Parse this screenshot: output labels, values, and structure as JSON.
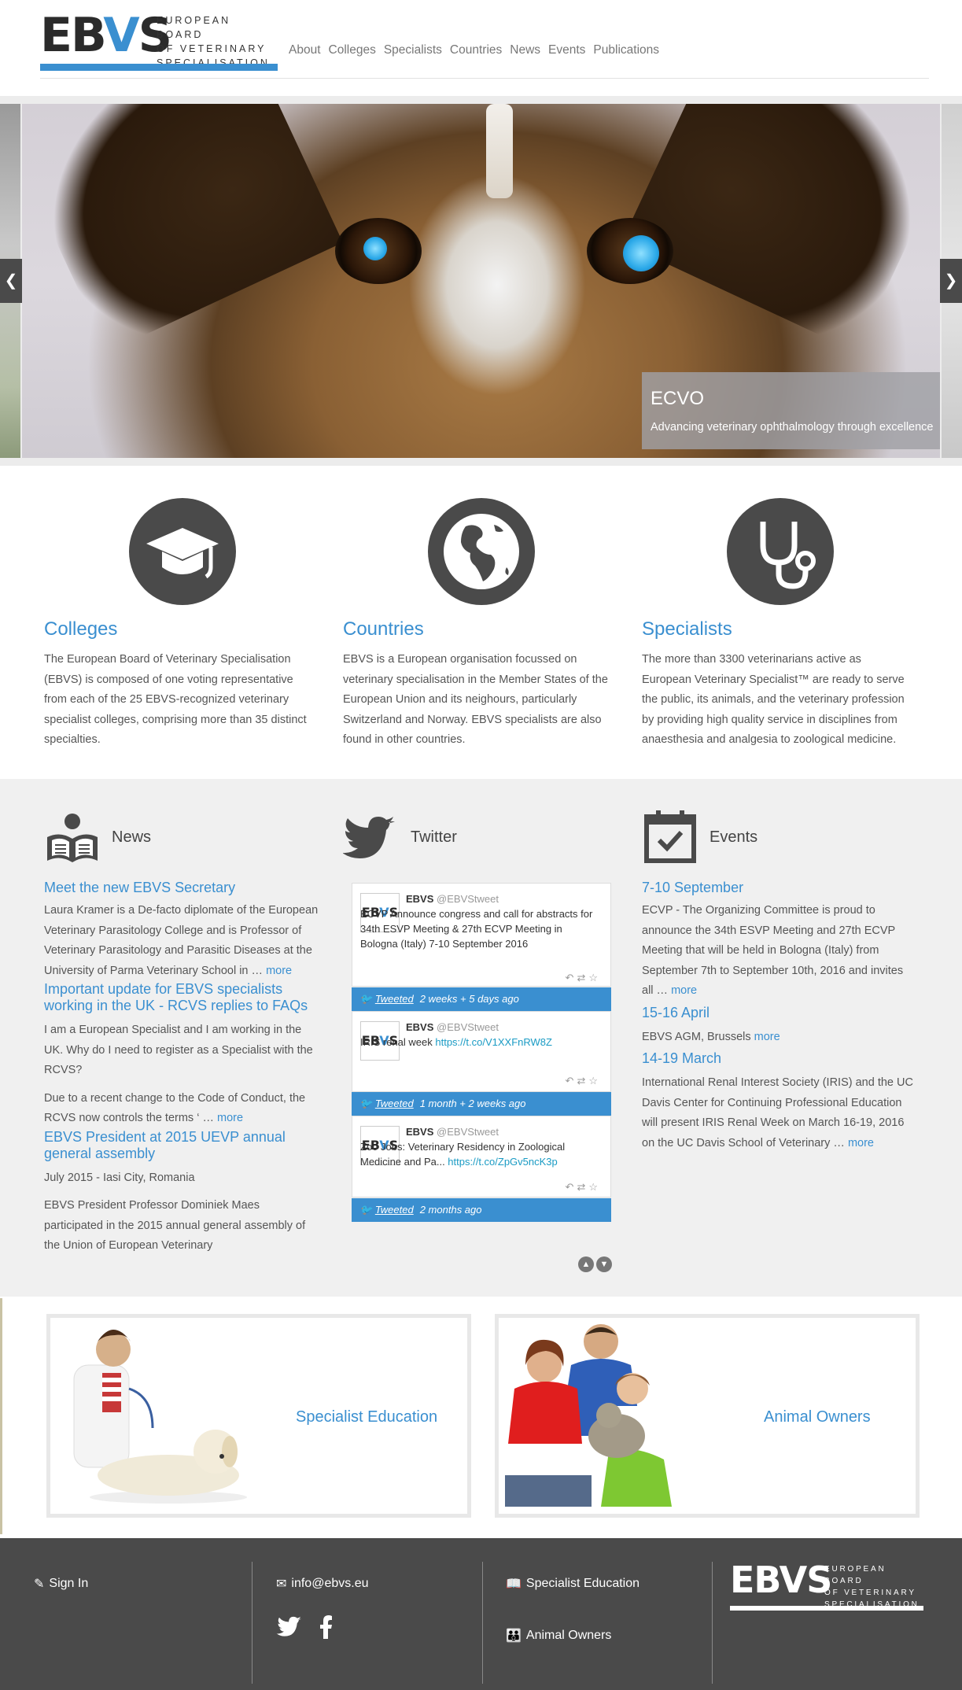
{
  "header": {
    "logo_mark_1": "EB",
    "logo_mark_v": "V",
    "logo_mark_2": "S",
    "logo_lines": [
      "EUROPEAN BOARD",
      "OF VETERINARY",
      "SPECIALISATION"
    ],
    "nav": [
      "About",
      "Colleges",
      "Specialists",
      "Countries",
      "News",
      "Events",
      "Publications"
    ]
  },
  "slider": {
    "caption_title": "ECVO",
    "caption_text": "Advancing veterinary ophthalmology through excellence"
  },
  "features": [
    {
      "title": "Colleges",
      "icon": "graduation-cap-icon",
      "text": "The European Board of Veterinary Specialisation (EBVS) is composed of one voting representative from each of the 25 EBVS-recognized veterinary specialist colleges, comprising more than 35 distinct specialties."
    },
    {
      "title": "Countries",
      "icon": "globe-icon",
      "text": "EBVS is a European organisation focussed on veterinary specialisation in the Member States of the European Union and its neighours, particularly Switzerland and Norway. EBVS specialists are also found in other countries."
    },
    {
      "title": "Specialists",
      "icon": "stethoscope-icon",
      "text": "The more than 3300 veterinarians active as European Veterinary Specialist™ are ready to serve the public, its animals, and the veterinary profession by providing high quality service in disciplines from anaesthesia and analgesia to zoological medicine."
    }
  ],
  "news": {
    "heading": "News",
    "items": [
      {
        "title": "Meet the new EBVS Secretary",
        "text": "Laura Kramer is a De-facto diplomate of the European Veterinary Parasitology College and is Professor of Veterinary Parasitology and Parasitic Diseases at the University of Parma Veterinary School in …",
        "more": "more"
      },
      {
        "title": "Important update for EBVS specialists working in the UK - RCVS replies to FAQs",
        "text": "I am a European Specialist and I am working in the UK. Why do I need to register as a Specialist with the RCVS?",
        "text2": "Due to a recent change to the Code of Conduct, the RCVS now controls the terms ‘ …",
        "more": "more"
      },
      {
        "title": "EBVS President at 2015 UEVP annual general assembly",
        "text": "July 2015 - Iasi City, Romania",
        "text2": "EBVS President Professor Dominiek Maes participated in the 2015 annual general assembly of the Union of European Veterinary"
      }
    ]
  },
  "twitter": {
    "heading": "Twitter",
    "tweets": [
      {
        "name": "EBVS",
        "handle": "@EBVStweet",
        "text": "ECVP Announce congress and call for abstracts for 34th ESVP Meeting & 27th ECVP Meeting in Bologna (Italy) 7-10 September 2016",
        "link": "",
        "tweeted": "Tweeted",
        "ago": "2 weeks + 5 days ago"
      },
      {
        "name": "EBVS",
        "handle": "@EBVStweet",
        "text": "IRIS renal week ",
        "link": "https://t.co/V1XXFnRW8Z",
        "tweeted": "Tweeted",
        "ago": "1 month + 2 weeks ago"
      },
      {
        "name": "EBVS",
        "handle": "@EBVStweet",
        "text": "Zoo Jobs: Veterinary Residency in Zoological Medicine and Pa... ",
        "link": "https://t.co/ZpGv5ncK3p",
        "tweeted": "Tweeted",
        "ago": "2 months ago"
      }
    ]
  },
  "events": {
    "heading": "Events",
    "items": [
      {
        "title": "7-10 September",
        "text": "ECVP - The Organizing Committee is proud to announce the 34th ESVP Meeting and 27th ECVP Meeting that will be held in Bologna (Italy) from September 7th to September 10th, 2016 and invites all …",
        "more": "more"
      },
      {
        "title": "15-16 April",
        "text": "EBVS AGM, Brussels",
        "more": "more"
      },
      {
        "title": "14-19 March",
        "text": "International Renal Interest Society (IRIS) and the UC Davis Center for Continuing Professional Education will present IRIS Renal Week on March 16-19, 2016 on the UC Davis School of Veterinary …",
        "more": "more"
      }
    ]
  },
  "promos": {
    "left_label": "Specialist Education",
    "right_label": "Animal Owners"
  },
  "footer": {
    "sign_in": "Sign In",
    "email": "info@ebvs.eu",
    "specialist_education": "Specialist Education",
    "animal_owners": "Animal Owners",
    "logo_mark": "EBVS",
    "logo_lines": [
      "EUROPEAN BOARD",
      "OF VETERINARY",
      "SPECIALISATION"
    ]
  },
  "colors": {
    "accent": "#3a8fd0",
    "dark": "#4a4a4a",
    "panel": "#f0f0f0"
  }
}
